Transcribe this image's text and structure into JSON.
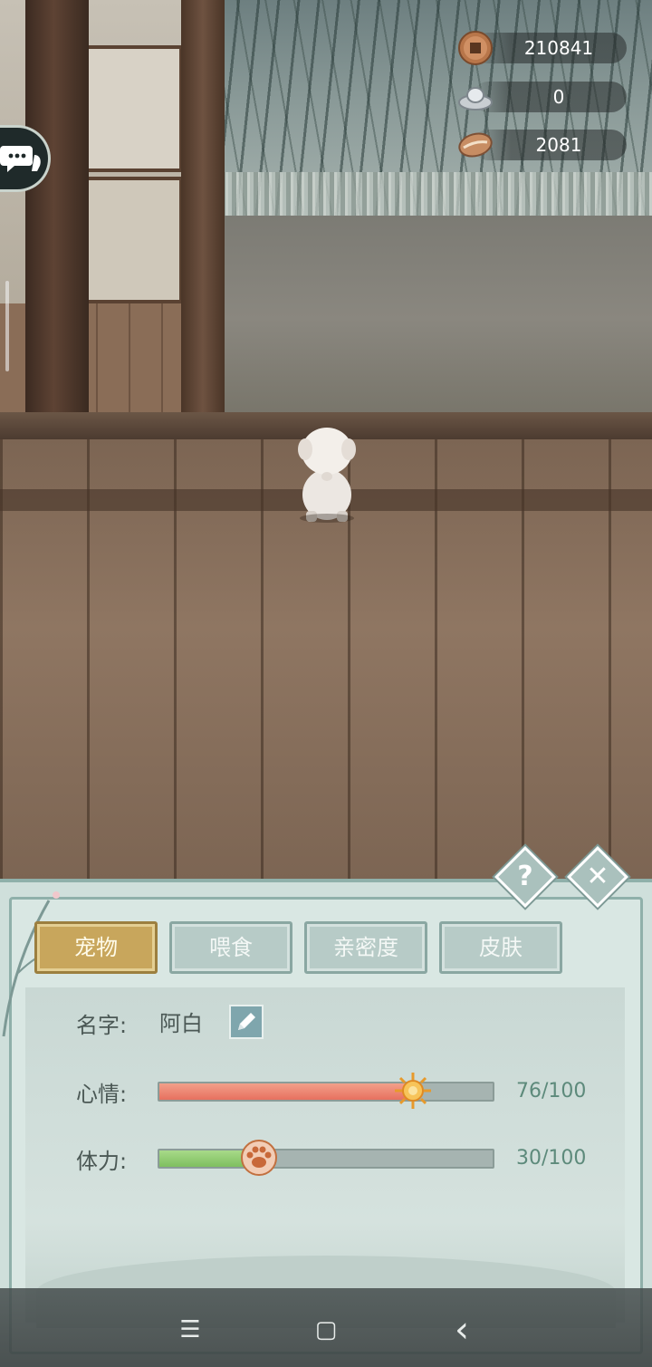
{
  "currencies": [
    {
      "name": "copper-coin",
      "value": "210841"
    },
    {
      "name": "silver-ingot",
      "value": "0"
    },
    {
      "name": "shell",
      "value": "2081"
    }
  ],
  "panel": {
    "tabs": [
      {
        "label": "宠物",
        "active": true
      },
      {
        "label": "喂食",
        "active": false
      },
      {
        "label": "亲密度",
        "active": false
      },
      {
        "label": "皮肤",
        "active": false
      }
    ],
    "help_label": "?",
    "close_label": "✕",
    "name_label": "名字:",
    "name_value": "阿白",
    "mood_label": "心情:",
    "mood_value": "76/100",
    "mood_fraction": 0.76,
    "stamina_label": "体力:",
    "stamina_value": "30/100",
    "stamina_fraction": 0.3
  },
  "colors": {
    "active_tab": "#c8a65c",
    "mood_bar": "#e7705f",
    "stamina_bar": "#7fbf5f",
    "value_text": "#5d8a7b"
  },
  "nav": {
    "menu_icon": "☰",
    "home_icon": "▢",
    "back_icon": "‹"
  }
}
